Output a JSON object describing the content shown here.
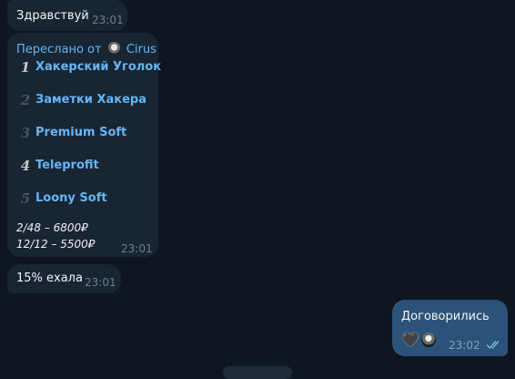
{
  "messages": [
    {
      "text": "Здравствуй",
      "time": "23:01"
    },
    {
      "forwarded_prefix": "Переслано от",
      "forwarded_from": "Cirus",
      "items": [
        {
          "number": "1",
          "label": "Хакерский Уголок"
        },
        {
          "number": "2",
          "label": "Заметки Хакера"
        },
        {
          "number": "3",
          "label": "Premium Soft"
        },
        {
          "number": "4",
          "label": "Teleprofit"
        },
        {
          "number": "5",
          "label": "Loony Soft"
        }
      ],
      "prices": [
        "2/48 – 6800₽",
        "12/12 – 5500₽"
      ],
      "time": "23:01"
    },
    {
      "text": "15% ехала",
      "time": "23:01"
    },
    {
      "text": "Договорились",
      "emoji_heart": "🖤",
      "time": "23:02",
      "status": "read"
    }
  ],
  "colors": {
    "background": "#0e1621",
    "incoming_bubble": "#182533",
    "outgoing_bubble": "#2b5278",
    "link": "#64b5f6"
  }
}
